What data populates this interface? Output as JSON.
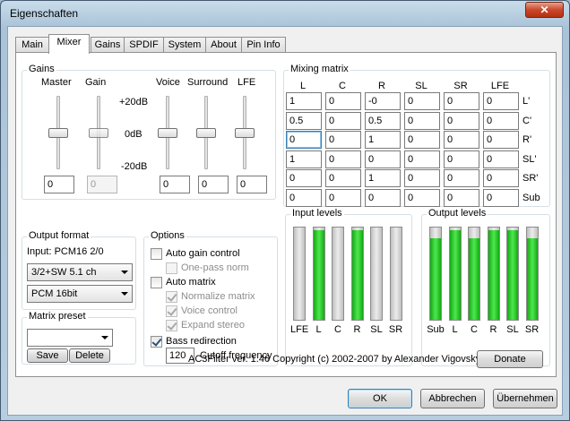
{
  "window": {
    "title": "Eigenschaften",
    "close_glyph": "✕"
  },
  "tabs": [
    {
      "label": "Main"
    },
    {
      "label": "Mixer"
    },
    {
      "label": "Gains"
    },
    {
      "label": "SPDIF"
    },
    {
      "label": "System"
    },
    {
      "label": "About"
    },
    {
      "label": "Pin Info"
    }
  ],
  "gains": {
    "title": "Gains",
    "labels": {
      "master": "Master",
      "gain": "Gain",
      "voice": "Voice",
      "surround": "Surround",
      "lfe": "LFE"
    },
    "scale": {
      "top": "+20dB",
      "mid": "0dB",
      "bottom": "-20dB"
    },
    "values": {
      "master": "0",
      "gain": "0",
      "voice": "0",
      "surround": "0",
      "lfe": "0"
    }
  },
  "mixing": {
    "title": "Mixing matrix",
    "cols": [
      "L",
      "C",
      "R",
      "SL",
      "SR",
      "LFE"
    ],
    "rows": [
      {
        "label": "L'",
        "cells": [
          "1",
          "0",
          "-0",
          "0",
          "0",
          "0"
        ]
      },
      {
        "label": "C'",
        "cells": [
          "0.5",
          "0",
          "0.5",
          "0",
          "0",
          "0"
        ]
      },
      {
        "label": "R'",
        "cells": [
          "0",
          "0",
          "1",
          "0",
          "0",
          "0"
        ]
      },
      {
        "label": "SL'",
        "cells": [
          "1",
          "0",
          "0",
          "0",
          "0",
          "0"
        ]
      },
      {
        "label": "SR'",
        "cells": [
          "0",
          "0",
          "1",
          "0",
          "0",
          "0"
        ]
      },
      {
        "label": "Sub",
        "cells": [
          "0",
          "0",
          "0",
          "0",
          "0",
          "0"
        ]
      }
    ]
  },
  "output_format": {
    "title": "Output format",
    "input_label": "Input: PCM16 2/0",
    "channels": "3/2+SW 5.1 ch",
    "format": "PCM 16bit"
  },
  "matrix_preset": {
    "title": "Matrix preset",
    "value": "",
    "save": "Save",
    "delete": "Delete"
  },
  "options": {
    "title": "Options",
    "auto_gain": {
      "label": "Auto gain control",
      "checked": false
    },
    "one_pass": {
      "label": "One-pass norm",
      "checked": false
    },
    "auto_matrix": {
      "label": "Auto matrix",
      "checked": false
    },
    "normalize": {
      "label": "Normalize matrix",
      "checked": true
    },
    "voice_control": {
      "label": "Voice control",
      "checked": true
    },
    "expand_stereo": {
      "label": "Expand stereo",
      "checked": true
    },
    "bass_redirection": {
      "label": "Bass redirection",
      "checked": true
    },
    "cutoff_value": "120",
    "cutoff_label": "Cutoff frequency"
  },
  "input_levels": {
    "title": "Input levels",
    "channels": [
      {
        "label": "LFE",
        "level": 0
      },
      {
        "label": "L",
        "level": 0.97
      },
      {
        "label": "C",
        "level": 0
      },
      {
        "label": "R",
        "level": 0.97
      },
      {
        "label": "SL",
        "level": 0
      },
      {
        "label": "SR",
        "level": 0
      }
    ]
  },
  "output_levels": {
    "title": "Output levels",
    "channels": [
      {
        "label": "Sub",
        "level": 0.88
      },
      {
        "label": "L",
        "level": 0.97
      },
      {
        "label": "C",
        "level": 0.88
      },
      {
        "label": "R",
        "level": 0.97
      },
      {
        "label": "SL",
        "level": 0.97
      },
      {
        "label": "SR",
        "level": 0.88
      }
    ]
  },
  "footer": {
    "copyright": "AC3Filter ver. 1.46 Copyright (c) 2002-2007 by Alexander Vigovsky",
    "donate": "Donate"
  },
  "dialog_buttons": {
    "ok": "OK",
    "cancel": "Abbrechen",
    "apply": "Übernehmen"
  }
}
